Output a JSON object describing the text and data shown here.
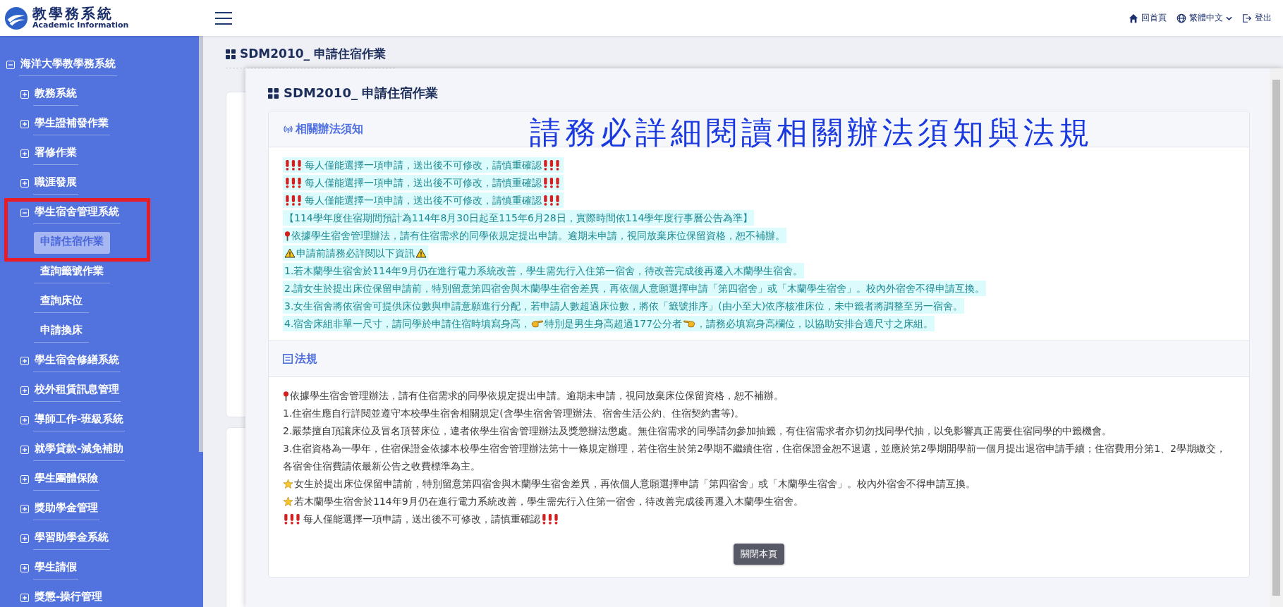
{
  "header": {
    "logo_title": "教學務系統",
    "logo_subtitle": "Academic Information",
    "links": [
      {
        "kind": "home",
        "label": "回首頁"
      },
      {
        "kind": "language",
        "label": "繁體中文"
      },
      {
        "kind": "logout",
        "label": "登出"
      }
    ]
  },
  "sidebar": {
    "items": [
      {
        "label": "海洋大學教學務系統",
        "expanded": true,
        "selected": false,
        "children": [
          {
            "label": "教務系統",
            "expanded": false,
            "selected": false
          },
          {
            "label": "學生證補發作業",
            "expanded": false,
            "selected": false
          },
          {
            "label": "署修作業",
            "expanded": false,
            "selected": false
          },
          {
            "label": "職涯發展",
            "expanded": false,
            "selected": false
          },
          {
            "label": "學生宿舍管理系統",
            "expanded": true,
            "selected": false,
            "highlighted": true,
            "children": [
              {
                "label": "申請住宿作業",
                "selected": true
              },
              {
                "label": "查詢籤號作業",
                "selected": false
              },
              {
                "label": "查詢床位",
                "selected": false
              },
              {
                "label": "申請換床",
                "selected": false
              }
            ]
          },
          {
            "label": "學生宿舍修繕系統",
            "expanded": false,
            "selected": false
          },
          {
            "label": "校外租賃訊息管理",
            "expanded": false,
            "selected": false
          },
          {
            "label": "導師工作-班級系統",
            "expanded": false,
            "selected": false
          },
          {
            "label": "就學貸款-減免補助",
            "expanded": false,
            "selected": false
          },
          {
            "label": "學生團體保險",
            "expanded": false,
            "selected": false
          },
          {
            "label": "獎助學金管理",
            "expanded": false,
            "selected": false
          },
          {
            "label": "學習助學金系統",
            "expanded": false,
            "selected": false
          },
          {
            "label": "學生請假",
            "expanded": false,
            "selected": false
          },
          {
            "label": "獎懲-操行管理",
            "expanded": false,
            "selected": false
          }
        ]
      }
    ]
  },
  "page": {
    "title": "SDM2010_ 申請住宿作業"
  },
  "dialog": {
    "title": "SDM2010_ 申請住宿作業",
    "notice": {
      "heading": "相關辦法須知",
      "banner": "請務必詳細閱讀相關辦法須知與法規",
      "lines": [
        {
          "kind": "alert",
          "text": "每人僅能選擇一項申請，送出後不可修改，請慎重確認"
        },
        {
          "kind": "alert",
          "text": "每人僅能選擇一項申請，送出後不可修改，請慎重確認"
        },
        {
          "kind": "alert",
          "text": "每人僅能選擇一項申請，送出後不可修改，請慎重確認"
        },
        {
          "kind": "plain",
          "text": "【114學年度住宿期間預計為114年8月30日起至115年6月28日，實際時間依114學年度行事曆公告為準】"
        },
        {
          "kind": "pin",
          "text": "依據學生宿舍管理辦法，請有住宿需求的同學依規定提出申請。逾期未申請，視同放棄床位保留資格，恕不補辦。"
        },
        {
          "kind": "caution",
          "text": "申請前請務必詳閱以下資訊"
        },
        {
          "kind": "plain",
          "text": "1.若木蘭學生宿舍於114年9月仍在進行電力系統改善，學生需先行入住第一宿舍，待改善完成後再遷入木蘭學生宿舍。"
        },
        {
          "kind": "plain",
          "text": "2.請女生於提出床位保留申請前，特別留意第四宿舍與木蘭學生宿舍差異，再依個人意願選擇申請「第四宿舍」或「木蘭學生宿舍」。校內外宿舍不得申請互換。"
        },
        {
          "kind": "plain",
          "text": "3.女生宿舍將依宿舍可提供床位數與申請意願進行分配，若申請人數超過床位數，將依「籤號排序」(由小至大)依序核准床位，未中籤者將調整至另一宿舍。"
        },
        {
          "kind": "pointing",
          "segments": [
            "4.宿舍床組非單一尺寸，請同學於申請住宿時填寫身高，",
            "特別是男生身高超過177公分者",
            "，請務必填寫身高欄位，以協助安排合適尺寸之床組。"
          ]
        }
      ]
    },
    "regulations": {
      "heading": "法規",
      "lines": [
        {
          "kind": "pin",
          "text": "依據學生宿舍管理辦法，請有住宿需求的同學依規定提出申請。逾期未申請，視同放棄床位保留資格，恕不補辦。"
        },
        {
          "kind": "plain",
          "text": "1.住宿生應自行詳閱並遵守本校學生宿舍相關規定(含學生宿舍管理辦法、宿舍生活公約、住宿契約書等)。"
        },
        {
          "kind": "plain",
          "text": "2.嚴禁擅自頂讓床位及冒名頂替床位，違者依學生宿舍管理辦法及獎懲辦法懲處。無住宿需求的同學請勿參加抽籤，有住宿需求者亦切勿找同學代抽，以免影響真正需要住宿同學的中籤機會。"
        },
        {
          "kind": "plain",
          "text": "3.住宿資格為一學年，住宿保證金依據本校學生宿舍管理辦法第十一條規定辦理，若住宿生於第2學期不繼續住宿，住宿保證金恕不退還，並應於第2學期開學前一個月提出退宿申請手續；住宿費用分第1、2學期繳交，各宿舍住宿費請依最新公告之收費標準為主。"
        },
        {
          "kind": "star",
          "text": "女生於提出床位保留申請前，特別留意第四宿舍與木蘭學生宿舍差異，再依個人意願選擇申請「第四宿舍」或「木蘭學生宿舍」。校內外宿舍不得申請互換。"
        },
        {
          "kind": "star",
          "text": "若木蘭學生宿舍於114年9月仍在進行電力系統改善，學生需先行入住第一宿舍，待改善完成後再遷入木蘭學生宿舍。"
        },
        {
          "kind": "alert",
          "text": "每人僅能選擇一項申請，送出後不可修改，請慎重確認"
        }
      ]
    },
    "close_button": "關閉本頁"
  }
}
